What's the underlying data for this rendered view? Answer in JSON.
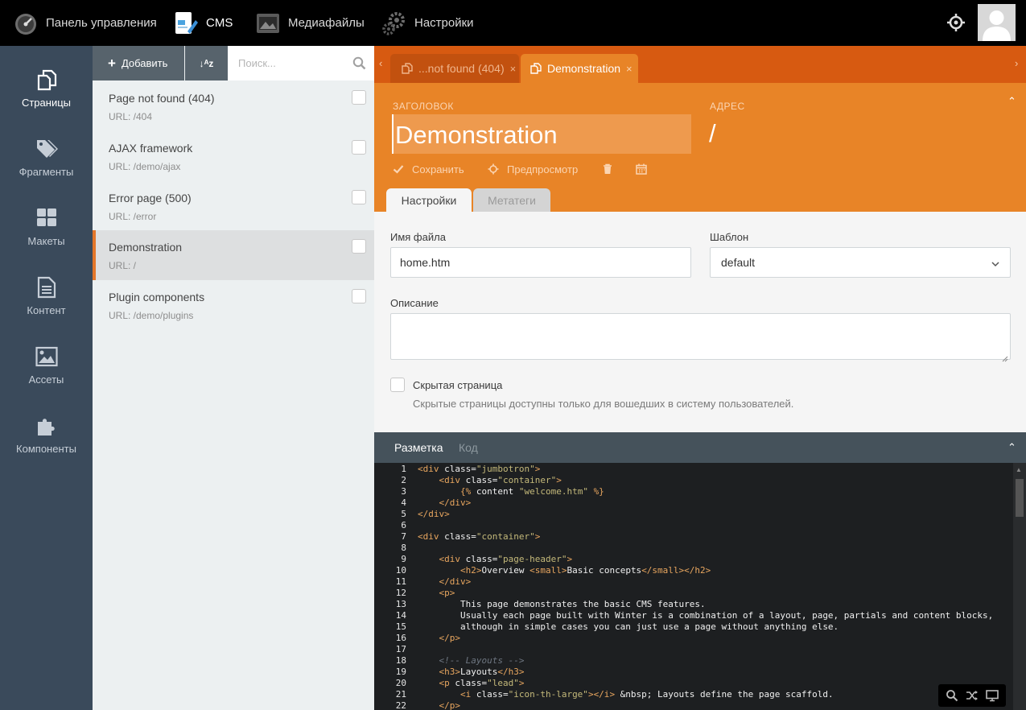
{
  "topbar": {
    "nav": [
      {
        "label": "Панель управления",
        "icon": "speedometer-icon",
        "active": false
      },
      {
        "label": "CMS",
        "icon": "cms-icon",
        "active": true
      },
      {
        "label": "Медиафайлы",
        "icon": "media-icon",
        "active": false
      },
      {
        "label": "Настройки",
        "icon": "gears-icon",
        "active": false
      }
    ],
    "right_icon": "crosshair-icon",
    "avatar_icon": "user-avatar-icon"
  },
  "sidebar": {
    "items": [
      {
        "label": "Страницы",
        "icon": "pages-icon",
        "active": true
      },
      {
        "label": "Фрагменты",
        "icon": "tags-icon",
        "active": false
      },
      {
        "label": "Макеты",
        "icon": "layouts-icon",
        "active": false
      },
      {
        "label": "Контент",
        "icon": "content-icon",
        "active": false
      },
      {
        "label": "Ассеты",
        "icon": "image-icon",
        "active": false
      },
      {
        "label": "Компоненты",
        "icon": "puzzle-icon",
        "active": false
      }
    ]
  },
  "list": {
    "add_label": "Добавить",
    "sort_label": "↓ᴬz",
    "search_placeholder": "Поиск...",
    "pages": [
      {
        "title": "Page not found (404)",
        "url": "URL: /404",
        "active": false
      },
      {
        "title": "AJAX framework",
        "url": "URL: /demo/ajax",
        "active": false
      },
      {
        "title": "Error page (500)",
        "url": "URL: /error",
        "active": false
      },
      {
        "title": "Demonstration",
        "url": "URL: /",
        "active": true
      },
      {
        "title": "Plugin components",
        "url": "URL: /demo/plugins",
        "active": false
      }
    ]
  },
  "tabs": {
    "left_arrow": "‹",
    "right_arrow": "›",
    "items": [
      {
        "label": "...not found (404)",
        "close": "×",
        "active": false
      },
      {
        "label": "Demonstration",
        "close": "×",
        "active": true
      }
    ]
  },
  "header": {
    "title_label": "ЗАГОЛОВОК",
    "url_label": "АДРЕС",
    "title_value": "Demonstration",
    "url_value": "/",
    "collapse": "⌃",
    "save_label": "Сохранить",
    "preview_label": "Предпросмотр",
    "form_tabs": [
      {
        "label": "Настройки",
        "active": true
      },
      {
        "label": "Метатеги",
        "active": false
      }
    ]
  },
  "form": {
    "filename_label": "Имя файла",
    "filename_value": "home.htm",
    "layout_label": "Шаблон",
    "layout_value": "default",
    "description_label": "Описание",
    "description_value": "",
    "hidden_label": "Скрытая страница",
    "hidden_help": "Скрытые страницы доступны только для вошедших в систему пользователей."
  },
  "editor": {
    "tabs": [
      {
        "label": "Разметка",
        "active": true
      },
      {
        "label": "Код",
        "active": false
      }
    ],
    "collapse": "⌃",
    "line_numbers": [
      "1",
      "2",
      "3",
      "4",
      "5",
      "6",
      "7",
      "8",
      "9",
      "10",
      "11",
      "12",
      "13",
      "14",
      "15",
      "16",
      "17",
      "18",
      "19",
      "20",
      "21",
      "22"
    ],
    "lines": [
      "<div class=\"jumbotron\">",
      "    <div class=\"container\">",
      "        {% content \"welcome.htm\" %}",
      "    </div>",
      "</div>",
      "",
      "<div class=\"container\">",
      "",
      "    <div class=\"page-header\">",
      "        <h2>Overview <small>Basic concepts</small></h2>",
      "    </div>",
      "    <p>",
      "        This page demonstrates the basic CMS features.",
      "        Usually each page built with Winter is a combination of a layout, page, partials and content blocks,",
      "        although in simple cases you can just use a page without anything else.",
      "    </p>",
      "",
      "    <!-- Layouts -->",
      "    <h3>Layouts</h3>",
      "    <p class=\"lead\">",
      "        <i class=\"icon-th-large\"></i> &nbsp; Layouts define the page scaffold.",
      "    </p>"
    ],
    "toolbar_icons": [
      "search-icon",
      "shuffle-icon",
      "fullscreen-icon"
    ]
  },
  "colors": {
    "accent": "#e88427",
    "accent_dark": "#d75a11",
    "sidebar": "#3a4a5b",
    "editor_bg": "#1d1f21"
  }
}
